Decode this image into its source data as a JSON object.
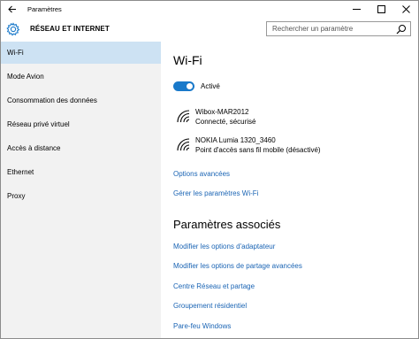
{
  "window": {
    "title": "Paramètres",
    "back_icon": "arrow-left-icon",
    "controls": [
      "minimize-icon",
      "maximize-icon",
      "close-icon"
    ]
  },
  "header": {
    "icon": "gear-icon",
    "section_title": "RÉSEAU ET INTERNET",
    "search": {
      "placeholder": "Rechercher un paramètre",
      "icon": "search-icon"
    }
  },
  "sidebar": {
    "items": [
      {
        "label": "Wi-Fi",
        "active": true
      },
      {
        "label": "Mode Avion"
      },
      {
        "label": "Consommation des données"
      },
      {
        "label": "Réseau privé virtuel"
      },
      {
        "label": "Accès à distance"
      },
      {
        "label": "Ethernet"
      },
      {
        "label": "Proxy"
      }
    ]
  },
  "main": {
    "title": "Wi-Fi",
    "toggle": {
      "state": "on",
      "label": "Activé"
    },
    "networks": [
      {
        "name": "Wibox-MAR2012",
        "status": "Connecté, sécurisé",
        "icon": "wifi-icon"
      },
      {
        "name": "NOKIA Lumia 1320_3460",
        "status": "Point d'accès sans fil mobile (désactivé)",
        "icon": "wifi-icon"
      }
    ],
    "links": [
      "Options avancées",
      "Gérer les paramètres Wi-Fi"
    ],
    "related": {
      "title": "Paramètres associés",
      "links": [
        "Modifier les options d'adaptateur",
        "Modifier les options de partage avancées",
        "Centre Réseau et partage",
        "Groupement résidentiel",
        "Pare-feu Windows"
      ]
    }
  },
  "colors": {
    "accent": "#1979ca",
    "link": "#1a64b4",
    "sidebar_bg": "#f2f2f2",
    "selected_bg": "#cde2f3"
  }
}
